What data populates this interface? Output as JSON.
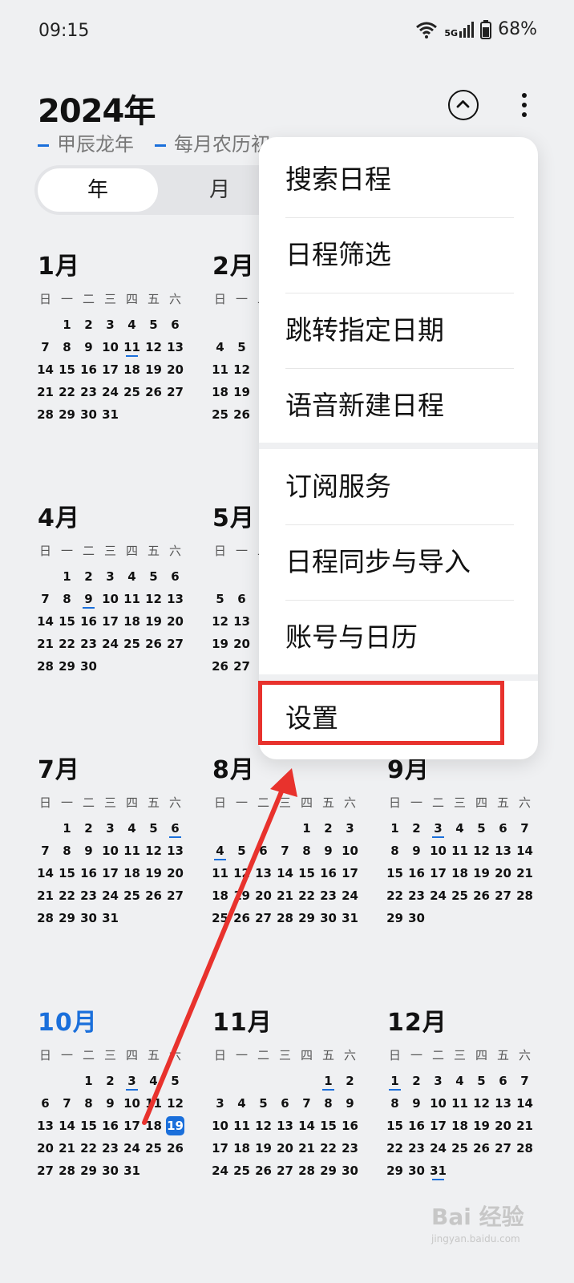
{
  "status": {
    "time": "09:15",
    "network": "5G",
    "battery": "68%"
  },
  "header": {
    "year": "2024年",
    "sub1": "甲辰龙年",
    "sub2": "每月农历初"
  },
  "tabs": [
    "年",
    "月"
  ],
  "weekdays": [
    "日",
    "一",
    "二",
    "三",
    "四",
    "五",
    "六"
  ],
  "months": [
    {
      "title": "1月",
      "weeks": [
        [
          "",
          "1",
          "2",
          "3",
          "4",
          "5",
          "6"
        ],
        [
          "7",
          "8",
          "9",
          "10",
          "11",
          "12",
          "13"
        ],
        [
          "14",
          "15",
          "16",
          "17",
          "18",
          "19",
          "20"
        ],
        [
          "21",
          "22",
          "23",
          "24",
          "25",
          "26",
          "27"
        ],
        [
          "28",
          "29",
          "30",
          "31",
          "",
          "",
          ""
        ]
      ],
      "marked": [
        "11"
      ]
    },
    {
      "title": "2月",
      "weeks": [
        [
          "",
          "",
          "",
          ""
        ],
        [
          "4",
          "5",
          "6"
        ],
        [
          "11",
          "12",
          "1"
        ],
        [
          "18",
          "19",
          "2"
        ],
        [
          "25",
          "26",
          "2"
        ]
      ],
      "marked": []
    },
    {
      "title": "4月",
      "weeks": [
        [
          "",
          "1",
          "2",
          "3",
          "4",
          "5",
          "6"
        ],
        [
          "7",
          "8",
          "9",
          "10",
          "11",
          "12",
          "13"
        ],
        [
          "14",
          "15",
          "16",
          "17",
          "18",
          "19",
          "20"
        ],
        [
          "21",
          "22",
          "23",
          "24",
          "25",
          "26",
          "27"
        ],
        [
          "28",
          "29",
          "30",
          "",
          "",
          "",
          ""
        ]
      ],
      "marked": [
        "9"
      ]
    },
    {
      "title": "5月",
      "weeks": [
        [
          "",
          "",
          "",
          ""
        ],
        [
          "5",
          "6",
          "7"
        ],
        [
          "12",
          "13",
          "1"
        ],
        [
          "19",
          "20",
          "2"
        ],
        [
          "26",
          "27",
          "2"
        ]
      ],
      "marked": []
    },
    {
      "title": "7月",
      "weeks": [
        [
          "",
          "1",
          "2",
          "3",
          "4",
          "5",
          "6"
        ],
        [
          "7",
          "8",
          "9",
          "10",
          "11",
          "12",
          "13"
        ],
        [
          "14",
          "15",
          "16",
          "17",
          "18",
          "19",
          "20"
        ],
        [
          "21",
          "22",
          "23",
          "24",
          "25",
          "26",
          "27"
        ],
        [
          "28",
          "29",
          "30",
          "31",
          "",
          "",
          ""
        ]
      ],
      "marked": [
        "6"
      ]
    },
    {
      "title": "8月",
      "weeks": [
        [
          "",
          "",
          "",
          "",
          "1",
          "2",
          "3"
        ],
        [
          "4",
          "5",
          "6",
          "7",
          "8",
          "9",
          "10"
        ],
        [
          "11",
          "12",
          "13",
          "14",
          "15",
          "16",
          "17"
        ],
        [
          "18",
          "19",
          "20",
          "21",
          "22",
          "23",
          "24"
        ],
        [
          "25",
          "26",
          "27",
          "28",
          "29",
          "30",
          "31"
        ]
      ],
      "marked": [
        "4"
      ]
    },
    {
      "title": "9月",
      "weeks": [
        [
          "1",
          "2",
          "3",
          "4",
          "5",
          "6",
          "7"
        ],
        [
          "8",
          "9",
          "10",
          "11",
          "12",
          "13",
          "14"
        ],
        [
          "15",
          "16",
          "17",
          "18",
          "19",
          "20",
          "21"
        ],
        [
          "22",
          "23",
          "24",
          "25",
          "26",
          "27",
          "28"
        ],
        [
          "29",
          "30",
          "",
          "",
          "",
          "",
          ""
        ]
      ],
      "marked": [
        "3"
      ]
    },
    {
      "title": "10月",
      "current": true,
      "weeks": [
        [
          "",
          "",
          "1",
          "2",
          "3",
          "4",
          "5"
        ],
        [
          "6",
          "7",
          "8",
          "9",
          "10",
          "11",
          "12"
        ],
        [
          "13",
          "14",
          "15",
          "16",
          "17",
          "18",
          "19"
        ],
        [
          "20",
          "21",
          "22",
          "23",
          "24",
          "25",
          "26"
        ],
        [
          "27",
          "28",
          "29",
          "30",
          "31",
          "",
          ""
        ]
      ],
      "marked": [
        "3"
      ],
      "today": "19"
    },
    {
      "title": "11月",
      "weeks": [
        [
          "",
          "",
          "",
          "",
          "",
          "1",
          "2"
        ],
        [
          "3",
          "4",
          "5",
          "6",
          "7",
          "8",
          "9"
        ],
        [
          "10",
          "11",
          "12",
          "13",
          "14",
          "15",
          "16"
        ],
        [
          "17",
          "18",
          "19",
          "20",
          "21",
          "22",
          "23"
        ],
        [
          "24",
          "25",
          "26",
          "27",
          "28",
          "29",
          "30"
        ]
      ],
      "marked": [
        "1"
      ]
    },
    {
      "title": "12月",
      "weeks": [
        [
          "1",
          "2",
          "3",
          "4",
          "5",
          "6",
          "7"
        ],
        [
          "8",
          "9",
          "10",
          "11",
          "12",
          "13",
          "14"
        ],
        [
          "15",
          "16",
          "17",
          "18",
          "19",
          "20",
          "21"
        ],
        [
          "22",
          "23",
          "24",
          "25",
          "26",
          "27",
          "28"
        ],
        [
          "29",
          "30",
          "31",
          "",
          "",
          "",
          ""
        ]
      ],
      "marked": [
        "1",
        "31"
      ]
    }
  ],
  "menu": {
    "items": [
      "搜索日程",
      "日程筛选",
      "跳转指定日期",
      "语音新建日程",
      "订阅服务",
      "日程同步与导入",
      "账号与日历",
      "设置"
    ],
    "highlight_color": "#e8322d"
  },
  "watermark": {
    "text": "Bai 经验",
    "sub": "jingyan.baidu.com"
  },
  "accent": "#1a6fdb"
}
